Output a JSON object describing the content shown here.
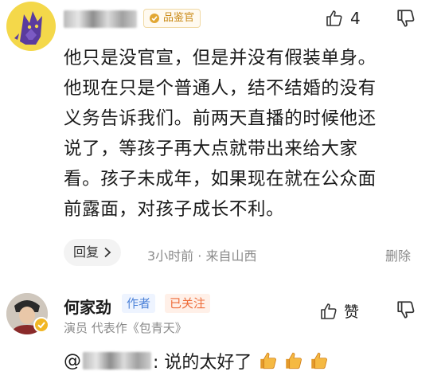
{
  "comment": {
    "avatar_icon": "wolf-avatar-icon",
    "badge_label": "品鉴官",
    "like_count": "4",
    "lines": [
      "他只是没官宣，但是并没有假装单身。",
      "他现在只是个普通人，结不结婚的没有",
      "义务告诉我们。前两天直播的时候他还",
      "说了，等孩子再大点就带出来给大家",
      "看。孩子未成年，如果现在就在公众面",
      "前露面，对孩子成长不利。"
    ],
    "reply_button": "回复",
    "time_location": "3小时前 · 来自山西",
    "delete_label": "删除"
  },
  "reply": {
    "username": "何家劲",
    "author_tag": "作者",
    "follow_tag": "已关注",
    "bio": "演员 代表作《包青天》",
    "like_label": "赞",
    "at_symbol": "@",
    "text": ": 说的太好了",
    "emojis": [
      "thumbs-up-emoji",
      "thumbs-up-emoji",
      "thumbs-up-emoji"
    ]
  },
  "colors": {
    "badge_gold": "#c98a16",
    "author_blue": "#4c82d8",
    "follow_orange": "#ee6d3a",
    "meta_gray": "#8a8a8a"
  }
}
